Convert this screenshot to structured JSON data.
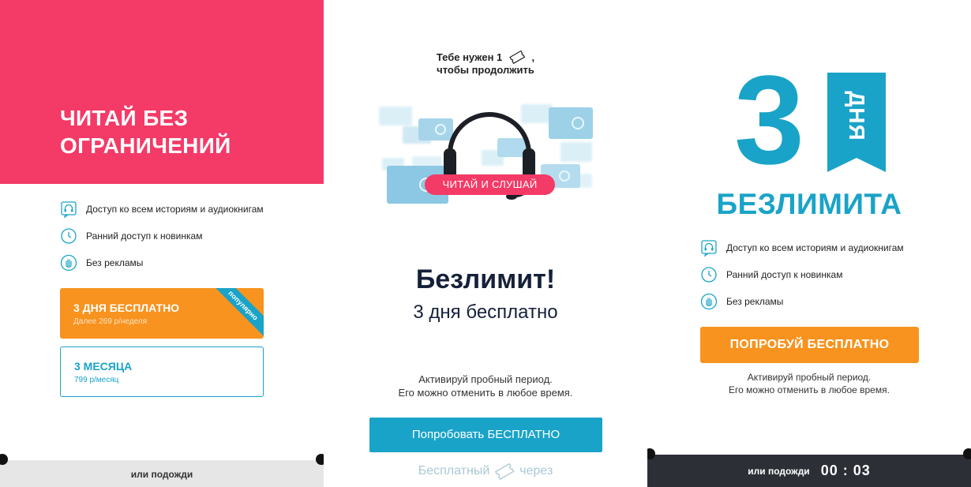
{
  "panel_left": {
    "title_line1": "ЧИТАЙ БЕЗ",
    "title_line2": "ОГРАНИЧЕНИЙ",
    "features": [
      {
        "icon": "headphones-icon",
        "label": "Доступ ко всем историям и аудиокнигам"
      },
      {
        "icon": "clock-icon",
        "label": "Ранний доступ к новинкам"
      },
      {
        "icon": "hand-icon",
        "label": "Без рекламы"
      }
    ],
    "plans": [
      {
        "name": "3 ДНЯ БЕСПЛАТНО",
        "sub": "Далее 269 р/неделя",
        "ribbon": "популярно"
      },
      {
        "name": "3 МЕСЯЦА",
        "sub": "799 р/месяц"
      }
    ],
    "footer": "или подожди"
  },
  "panel_center": {
    "need_line1": "Тебе нужен 1",
    "need_line1_suffix": ",",
    "need_line2": "чтобы продолжить",
    "badge": "ЧИТАЙ И СЛУШАЙ",
    "title": "Безлимит!",
    "subtitle": "3 дня бесплатно",
    "note_line1": "Активируй пробный период.",
    "note_line2": "Его можно отменить в любое время.",
    "button": "Попробовать БЕСПЛАТНО",
    "wait_prefix": "Бесплатный",
    "wait_suffix": "через"
  },
  "panel_right": {
    "big_number": "3",
    "flag_text": "ДНЯ",
    "unlimited": "БЕЗЛИМИТА",
    "features": [
      {
        "icon": "headphones-icon",
        "label": "Доступ ко всем историям и аудиокнигам"
      },
      {
        "icon": "clock-icon",
        "label": "Ранний доступ к новинкам"
      },
      {
        "icon": "hand-icon",
        "label": "Без рекламы"
      }
    ],
    "button": "ПОПРОБУЙ БЕСПЛАТНО",
    "note_line1": "Активируй пробный период.",
    "note_line2": "Его можно отменить в любое время.",
    "footer_wait": "или подожди",
    "timer": "00 : 03"
  },
  "colors": {
    "pink": "#f43a67",
    "blue": "#1aa3c8",
    "orange": "#f7931e",
    "navy": "#15213a",
    "dark_footer": "#2d2f37"
  }
}
